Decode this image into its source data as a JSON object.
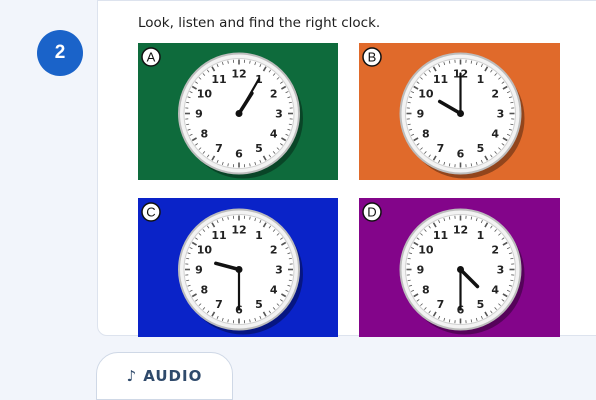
{
  "step": {
    "number": "2"
  },
  "exercise": {
    "instruction": "Look, listen and find the right clock.",
    "options": [
      {
        "letter": "A",
        "background": "#0e6b3c",
        "hour": 1,
        "minute": 5
      },
      {
        "letter": "B",
        "background": "#e06a2b",
        "hour": 10,
        "minute": 0
      },
      {
        "letter": "C",
        "background": "#0a23c8",
        "hour": 9,
        "minute": 30
      },
      {
        "letter": "D",
        "background": "#83058a",
        "hour": 4,
        "minute": 30
      }
    ]
  },
  "clock_face": {
    "numerals": [
      "12",
      "1",
      "2",
      "3",
      "4",
      "5",
      "6",
      "7",
      "8",
      "9",
      "10",
      "11"
    ]
  },
  "audio_button": {
    "icon": "music-note-icon",
    "glyph": "♪",
    "label": "AUDIO"
  },
  "colors": {
    "accent": "#1a63c9",
    "page_bg": "#f2f5fb"
  }
}
